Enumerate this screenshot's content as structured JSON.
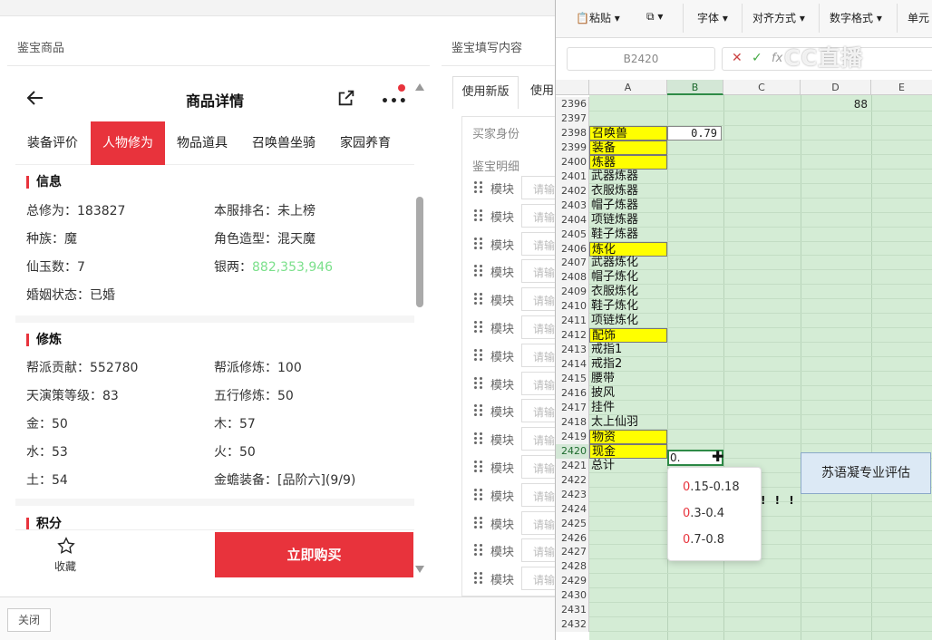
{
  "left": {
    "section_title": "鉴宝商品",
    "header_title": "商品详情",
    "tabs": [
      "装备评价",
      "人物修为",
      "物品道具",
      "召唤兽坐骑",
      "家园养育"
    ],
    "info": {
      "title": "信息",
      "total_cultivation": {
        "label": "总修为：",
        "value": "183827"
      },
      "server_rank": {
        "label": "本服排名：",
        "value": "未上榜"
      },
      "race": {
        "label": "种族：",
        "value": "魔"
      },
      "model": {
        "label": "角色造型：",
        "value": "混天魔"
      },
      "jade": {
        "label": "仙玉数：",
        "value": "7"
      },
      "silver": {
        "label": "银两：",
        "value": "882,353,946"
      },
      "marriage": {
        "label": "婚姻状态：",
        "value": "已婚"
      }
    },
    "training": {
      "title": "修炼",
      "guild_contribution": {
        "label": "帮派贡献：",
        "value": "552780"
      },
      "guild_training": {
        "label": "帮派修炼：",
        "value": "100"
      },
      "tianyan": {
        "label": "天演策等级：",
        "value": "83"
      },
      "wuxing": {
        "label": "五行修炼：",
        "value": "50"
      },
      "metal": {
        "label": "金：",
        "value": "50"
      },
      "wood": {
        "label": "木：",
        "value": "57"
      },
      "water": {
        "label": "水：",
        "value": "53"
      },
      "fire": {
        "label": "火：",
        "value": "50"
      },
      "earth": {
        "label": "土：",
        "value": "54"
      },
      "golden_gear": {
        "label": "金蟾装备：",
        "value": "[品阶六](9/9)"
      }
    },
    "points_title": "积分",
    "favorite_label": "收藏",
    "buy_label": "立即购买",
    "close_label": "关闭"
  },
  "middle": {
    "section_title": "鉴宝填写内容",
    "tab_new": "使用新版",
    "tab_other": "使用",
    "buyer_label": "买家身份",
    "detail_label": "鉴宝明细",
    "module_label": "模块",
    "input_placeholder": "请输",
    "rows": 15
  },
  "excel": {
    "ribbon": {
      "paste": "粘贴",
      "font": "字体",
      "align": "对齐方式",
      "number": "数字格式",
      "cell": "单元"
    },
    "name_box": "B2420",
    "watermark": "CC直播",
    "columns": [
      "A",
      "B",
      "C",
      "D",
      "E"
    ],
    "row_numbers": [
      "2396",
      "2397",
      "2398",
      "2399",
      "2400",
      "2401",
      "2402",
      "2403",
      "2404",
      "2405",
      "2406",
      "2407",
      "2408",
      "2409",
      "2410",
      "2411",
      "2412",
      "2413",
      "2414",
      "2415",
      "2416",
      "2417",
      "2418",
      "2419",
      "2420",
      "2421",
      "2422",
      "2423",
      "2424",
      "2425",
      "2426",
      "2427",
      "2428",
      "2429",
      "2430",
      "2431",
      "2432"
    ],
    "col_a": [
      {
        "row": "2398",
        "text": "召唤兽",
        "hl": true
      },
      {
        "row": "2399",
        "text": "装备",
        "hl": true
      },
      {
        "row": "2400",
        "text": "炼器",
        "hl": true
      },
      {
        "row": "2401",
        "text": "武器炼器",
        "hl": false
      },
      {
        "row": "2402",
        "text": "衣服炼器",
        "hl": false
      },
      {
        "row": "2403",
        "text": "帽子炼器",
        "hl": false
      },
      {
        "row": "2404",
        "text": "项链炼器",
        "hl": false
      },
      {
        "row": "2405",
        "text": "鞋子炼器",
        "hl": false
      },
      {
        "row": "2406",
        "text": "炼化",
        "hl": true
      },
      {
        "row": "2407",
        "text": "武器炼化",
        "hl": false
      },
      {
        "row": "2408",
        "text": "帽子炼化",
        "hl": false
      },
      {
        "row": "2409",
        "text": "衣服炼化",
        "hl": false
      },
      {
        "row": "2410",
        "text": "鞋子炼化",
        "hl": false
      },
      {
        "row": "2411",
        "text": "项链炼化",
        "hl": false
      },
      {
        "row": "2412",
        "text": "配饰",
        "hl": true
      },
      {
        "row": "2413",
        "text": "戒指1",
        "hl": false
      },
      {
        "row": "2414",
        "text": "戒指2",
        "hl": false
      },
      {
        "row": "2415",
        "text": "腰带",
        "hl": false
      },
      {
        "row": "2416",
        "text": "披风",
        "hl": false
      },
      {
        "row": "2417",
        "text": "挂件",
        "hl": false
      },
      {
        "row": "2418",
        "text": "太上仙羽",
        "hl": false
      },
      {
        "row": "2419",
        "text": "物资",
        "hl": true
      },
      {
        "row": "2420",
        "text": "现金",
        "hl": true
      },
      {
        "row": "2421",
        "text": "总计",
        "hl": false
      }
    ],
    "b2398": "0.79",
    "d2396": "88",
    "active_value": "0.",
    "dropdown": [
      {
        "prefix": "0",
        "rest": ".15-0.18"
      },
      {
        "prefix": "0",
        "rest": ".3-0.4"
      },
      {
        "prefix": "0",
        "rest": ".7-0.8"
      }
    ],
    "eval_label": "苏语凝专业评估",
    "exclaim": "! ! !"
  }
}
